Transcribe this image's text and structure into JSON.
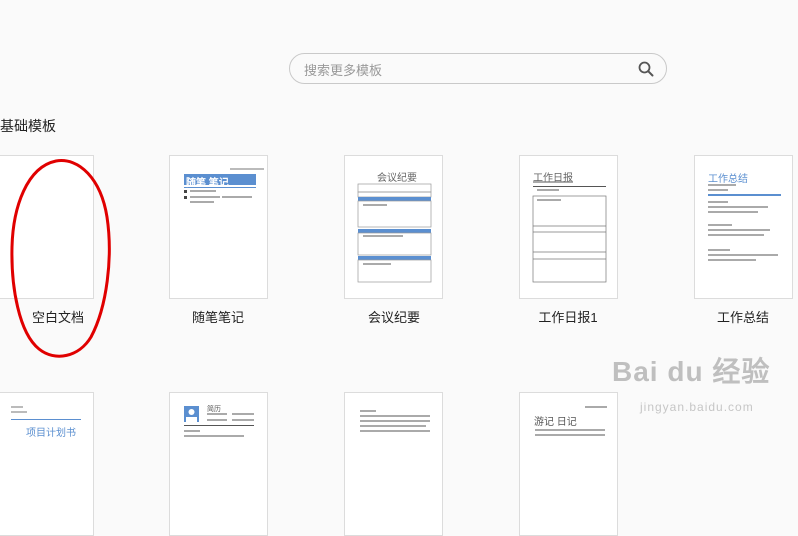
{
  "search": {
    "placeholder": "搜索更多模板"
  },
  "section": {
    "title": "基础模板"
  },
  "templates": [
    {
      "label": "空白文档"
    },
    {
      "label": "随笔笔记",
      "thumb_title": "随笔 笔记"
    },
    {
      "label": "会议纪要",
      "thumb_title": "会议纪要"
    },
    {
      "label": "工作日报1",
      "thumb_title": "工作日报"
    },
    {
      "label": "工作总结",
      "thumb_title": "工作总结"
    }
  ],
  "second_row": [
    {
      "thumb_title": "项目计划书"
    },
    {
      "thumb_title": "简历"
    },
    {
      "thumb_title": ""
    },
    {
      "thumb_title": "游记 日记"
    }
  ],
  "watermark": {
    "logo": "Bai du 经验",
    "url": "jingyan.baidu.com"
  },
  "colors": {
    "accent": "#5b8fd0",
    "annotation": "#e00000"
  }
}
